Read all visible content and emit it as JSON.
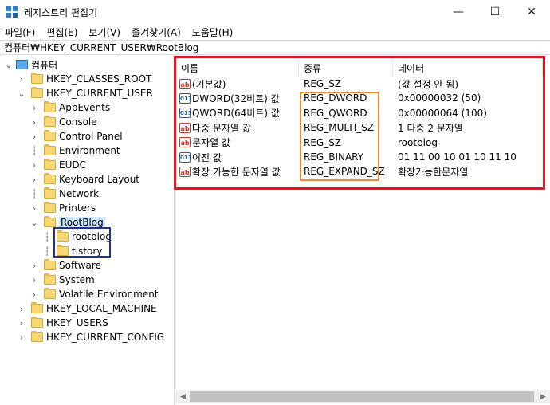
{
  "window": {
    "title": "레지스트리 편집기",
    "minimize_glyph": "—",
    "maximize_glyph": "☐",
    "close_glyph": "✕"
  },
  "menu": [
    "파일(F)",
    "편집(E)",
    "보기(V)",
    "즐겨찾기(A)",
    "도움말(H)"
  ],
  "address": "컴퓨터₩HKEY_CURRENT_USER₩RootBlog",
  "tree": {
    "root": "컴퓨터",
    "items": [
      "HKEY_CLASSES_ROOT",
      "HKEY_CURRENT_USER",
      "AppEvents",
      "Console",
      "Control Panel",
      "Environment",
      "EUDC",
      "Keyboard Layout",
      "Network",
      "Printers",
      "RootBlog",
      "rootblog",
      "tistory",
      "Software",
      "System",
      "Volatile Environment",
      "HKEY_LOCAL_MACHINE",
      "HKEY_USERS",
      "HKEY_CURRENT_CONFIG"
    ]
  },
  "list": {
    "columns": [
      "이름",
      "종류",
      "데이터"
    ],
    "rows": [
      {
        "icon": "ab",
        "name": "(기본값)",
        "type": "REG_SZ",
        "data": "(값 설정 안 됨)"
      },
      {
        "icon": "bin",
        "name": "DWORD(32비트) 값",
        "type": "REG_DWORD",
        "data": "0x00000032 (50)"
      },
      {
        "icon": "bin",
        "name": "QWORD(64비트) 값",
        "type": "REG_QWORD",
        "data": "0x00000064 (100)"
      },
      {
        "icon": "ab",
        "name": "다중 문자열 값",
        "type": "REG_MULTI_SZ",
        "data": "1 다중 2 문자열"
      },
      {
        "icon": "ab",
        "name": "문자열 값",
        "type": "REG_SZ",
        "data": "rootblog"
      },
      {
        "icon": "bin",
        "name": "이진 값",
        "type": "REG_BINARY",
        "data": "01 11 00 10 01 10 11 10"
      },
      {
        "icon": "ab",
        "name": "확장 가능한 문자열 값",
        "type": "REG_EXPAND_SZ",
        "data": "확장가능한문자열"
      }
    ],
    "icon_labels": {
      "ab": "ab",
      "bin": "011"
    }
  },
  "colors": {
    "highlight_red": "#e0151d",
    "highlight_orange": "#f28a2e",
    "highlight_blue": "#1f2fa8",
    "selection": "#cce8ff"
  }
}
